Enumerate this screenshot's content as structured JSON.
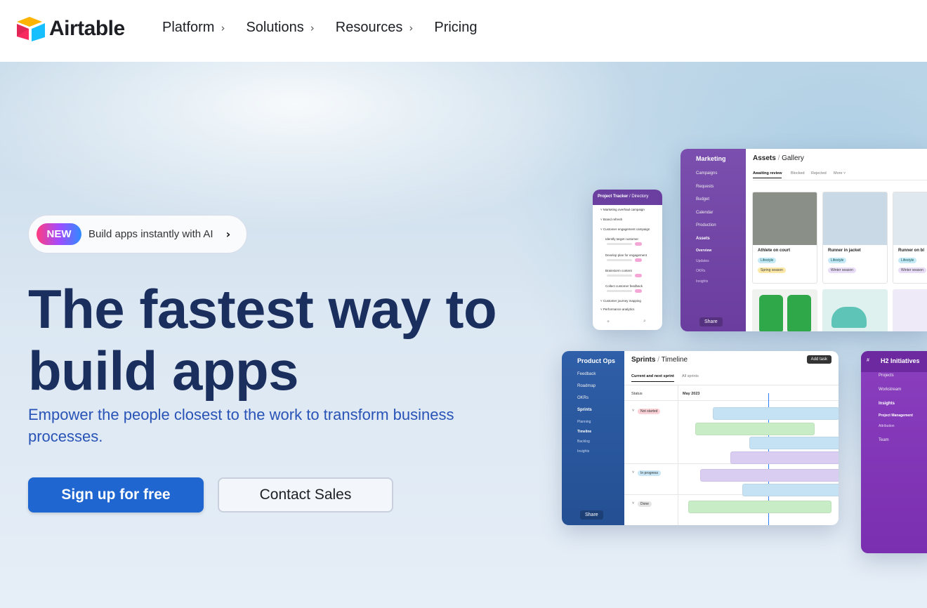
{
  "brand": {
    "name": "Airtable",
    "colors": [
      "#f82b60",
      "#fcb400",
      "#18bfff",
      "#2d7ff9"
    ]
  },
  "nav": {
    "items": [
      {
        "label": "Platform",
        "chevron": "›"
      },
      {
        "label": "Solutions",
        "chevron": "›"
      },
      {
        "label": "Resources",
        "chevron": "›"
      },
      {
        "label": "Pricing"
      }
    ]
  },
  "hero": {
    "badge_new": "NEW",
    "badge_text": "Build apps instantly with AI",
    "badge_arrow": "›",
    "headline_line1": "The fastest way to",
    "headline_line2": "build apps",
    "subheadline": "Empower the people closest to the work to transform business processes.",
    "cta_primary": "Sign up for free",
    "cta_secondary": "Contact Sales"
  },
  "mock": {
    "marketing": {
      "title": "Marketing",
      "items": [
        "Campaigns",
        "Requests",
        "Budget",
        "Calendar",
        "Production",
        "Assets"
      ],
      "sub": [
        "Overview",
        "Updates",
        "OKRs",
        "Insights"
      ],
      "share": "Share"
    },
    "gallery": {
      "title": "Assets",
      "view": "Gallery",
      "tabs": [
        "Awaiting review",
        "Blocked",
        "Rejected",
        "More"
      ],
      "cards": [
        {
          "name": "Athlete on court",
          "tags": [
            "Lifestyle",
            "Spring season"
          ]
        },
        {
          "name": "Runner in jacket",
          "tags": [
            "Lifestyle",
            "Winter season"
          ]
        },
        {
          "name": "Runner on bl",
          "tags": [
            "Lifestyle",
            "Winter season"
          ]
        }
      ]
    },
    "tracker": {
      "title": "Project Tracker",
      "view": "Directory",
      "rows": [
        "Marketing overhaul campaign",
        "Brand refresh",
        "Customer engagement campaign",
        "Identify target customer",
        "Develop plan for engagement",
        "Brainstorm content",
        "Collect customer feedback",
        "Customer journey mapping",
        "Performance analytics"
      ]
    },
    "product": {
      "title": "Product Ops",
      "items": [
        "Feedback",
        "Roadmap",
        "OKRs",
        "Sprints"
      ],
      "sub": [
        "Planning",
        "Timeline",
        "Backlog",
        "Insights"
      ],
      "share": "Share"
    },
    "timeline": {
      "title": "Sprints",
      "view": "Timeline",
      "tabs": [
        "Current and next sprint",
        "All sprints"
      ],
      "add": "Add task",
      "status_col": "Status",
      "month": "May 2023",
      "groups": [
        "Not started",
        "In progress",
        "Done"
      ]
    },
    "initiatives": {
      "title": "H2 Initiatives",
      "items": [
        "Projects",
        "Workstream",
        "Insights",
        "Team"
      ],
      "sub": [
        "Project Management",
        "Attribution"
      ]
    }
  }
}
